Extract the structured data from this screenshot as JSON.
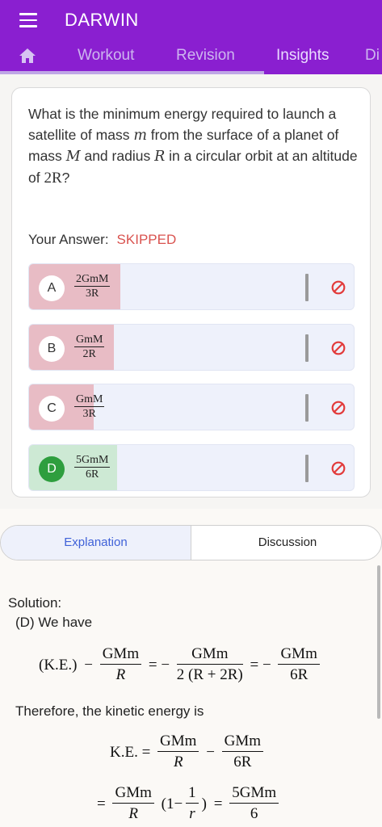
{
  "app": {
    "title": "DARWIN"
  },
  "tabs": [
    {
      "label": "Workout"
    },
    {
      "label": "Revision"
    },
    {
      "label": "Insights"
    },
    {
      "label": "Di"
    }
  ],
  "question": {
    "part1": "What is the minimum energy required to launch a satellite of mass ",
    "var_m": "m",
    "part2": " from the surface of a planet of mass ",
    "var_M": "M",
    "part3": " and radius ",
    "var_R": "R",
    "part4": " in a circular orbit at an altitude of ",
    "alt": "2R",
    "part5": "?"
  },
  "your_answer": {
    "label": "Your Answer:",
    "status": "SKIPPED"
  },
  "options": [
    {
      "letter": "A",
      "num": "2GmM",
      "den": "3R",
      "state": "wrong",
      "fill_fraction": 0.28
    },
    {
      "letter": "B",
      "num": "GmM",
      "den": "2R",
      "state": "wrong",
      "fill_fraction": 0.26
    },
    {
      "letter": "C",
      "num": "GmM",
      "den": "3R",
      "state": "wrong",
      "fill_fraction": 0.2
    },
    {
      "letter": "D",
      "num": "5GmM",
      "den": "6R",
      "state": "right",
      "fill_fraction": 0.27
    }
  ],
  "segments": {
    "explanation": "Explanation",
    "discussion": "Discussion"
  },
  "solution": {
    "label": "Solution:",
    "line1": "(D) We have",
    "line2": "Therefore, the kinetic energy is",
    "eq1": {
      "lhs": "(K.E.)",
      "f1_num": "GMm",
      "f1_den": "R",
      "f2_num": "GMm",
      "f2_den": "2 (R + 2R)",
      "f3_num": "GMm",
      "f3_den": "6R"
    },
    "eq2": {
      "lhs": "K.E. =",
      "f1_num": "GMm",
      "f1_den": "R",
      "f2_num": "GMm",
      "f2_den": "6R"
    },
    "eq3": {
      "f1_num": "GMm",
      "f1_den": "R",
      "paren_open": "(1−",
      "f2_num": "1",
      "f2_den": "r",
      "paren_close": ")",
      "f3_num": "5GMm",
      "f3_den": "6"
    }
  },
  "colors": {
    "header": "#8a1fd0",
    "wrong_fill": "#e8bcc5",
    "right_fill": "#cde9d4",
    "skipped": "#d9534f",
    "accent_blue": "#3f61d8"
  }
}
